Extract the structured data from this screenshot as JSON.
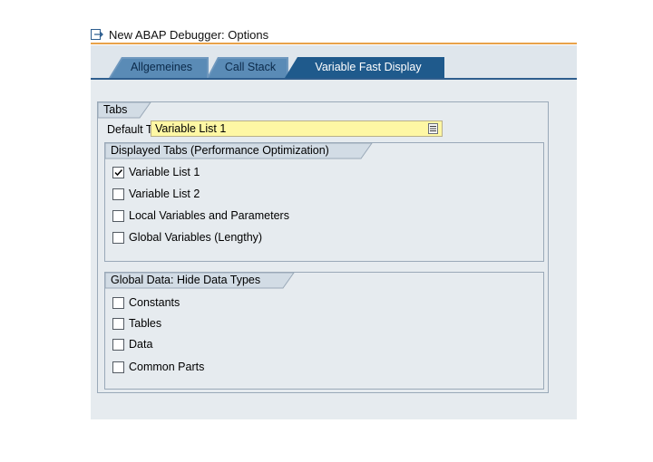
{
  "window": {
    "title": "New ABAP Debugger: Options"
  },
  "tabs": [
    {
      "label": "Allgemeines",
      "active": false
    },
    {
      "label": "Call Stack",
      "active": false
    },
    {
      "label": "Variable Fast Display",
      "active": true
    }
  ],
  "tabs_group": {
    "title": "Tabs",
    "default_tab_label": "Default Tab",
    "default_tab_value": "Variable List 1"
  },
  "displayed_tabs": {
    "title": "Displayed Tabs (Performance Optimization)",
    "items": [
      {
        "label": "Variable List 1",
        "checked": true
      },
      {
        "label": "Variable List 2",
        "checked": false
      },
      {
        "label": "Local Variables and Parameters",
        "checked": false
      },
      {
        "label": "Global Variables (Lengthy)",
        "checked": false
      }
    ]
  },
  "global_data": {
    "title": "Global Data: Hide Data Types",
    "items": [
      {
        "label": "Constants",
        "checked": false
      },
      {
        "label": "Tables",
        "checked": false
      },
      {
        "label": "Data",
        "checked": false
      },
      {
        "label": "Common Parts",
        "checked": false
      }
    ]
  },
  "colors": {
    "active_tab": "#1f5a8c",
    "inactive_tab": "#5a8bb6",
    "dropdown": "#fef7a4",
    "title_rule": "#e8a24a"
  }
}
